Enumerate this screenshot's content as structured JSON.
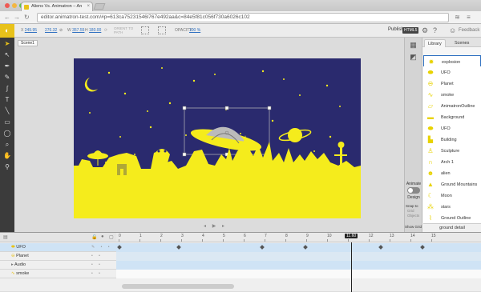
{
  "browser": {
    "tab_title": "Aliens Vs. Animatron – An",
    "url": "editor.animatron-test.com/#p=613ca75231546l767e492aa&c=84e5f81c056f730a6026c102"
  },
  "toolbar": {
    "x_label": "X",
    "x_value": "249.95",
    "y_value": "276.32",
    "w_label": "W",
    "w_value": "357.55",
    "h_label": "H",
    "h_value": "180.00",
    "orient_label": "ORIENT TO PATH",
    "opacity_label": "OPACITY",
    "opacity_value": "100 %",
    "publish_label": "Publish",
    "html5_label": "HTML5",
    "feedback_label": "Feedback"
  },
  "stage": {
    "scene_label": "Scene1"
  },
  "side": {
    "animate_label": "Animate",
    "design_label": "Design",
    "snap_to_label": "Snap to",
    "snap_options": [
      "Grid",
      "Objects"
    ],
    "show_grid_label": "Show Grid"
  },
  "library": {
    "tabs": [
      "Library",
      "Scenes"
    ],
    "items": [
      "explosion",
      "UFO",
      "Planet",
      "smoke",
      "AnimatronOutline",
      "Background",
      "UFO",
      "Building",
      "Sculpture",
      "Arch 1",
      "alien",
      "Ground Mountains",
      "Moon",
      "stars",
      "Ground Outline"
    ],
    "footer": "ground detail"
  },
  "timeline": {
    "ticks": [
      "0",
      "1",
      "2",
      "3",
      "4",
      "5",
      "6",
      "7",
      "8",
      "9",
      "10",
      "11",
      "12",
      "13",
      "14",
      "15"
    ],
    "playhead_label": "11.60",
    "layers": [
      "UFO",
      "Planet",
      "Audio",
      "smoke"
    ]
  },
  "colors": {
    "accent": "#e8c21a",
    "stage_bg": "#2a2a6e",
    "yellow": "#f5ec1c",
    "selection": "#2e70c0"
  }
}
